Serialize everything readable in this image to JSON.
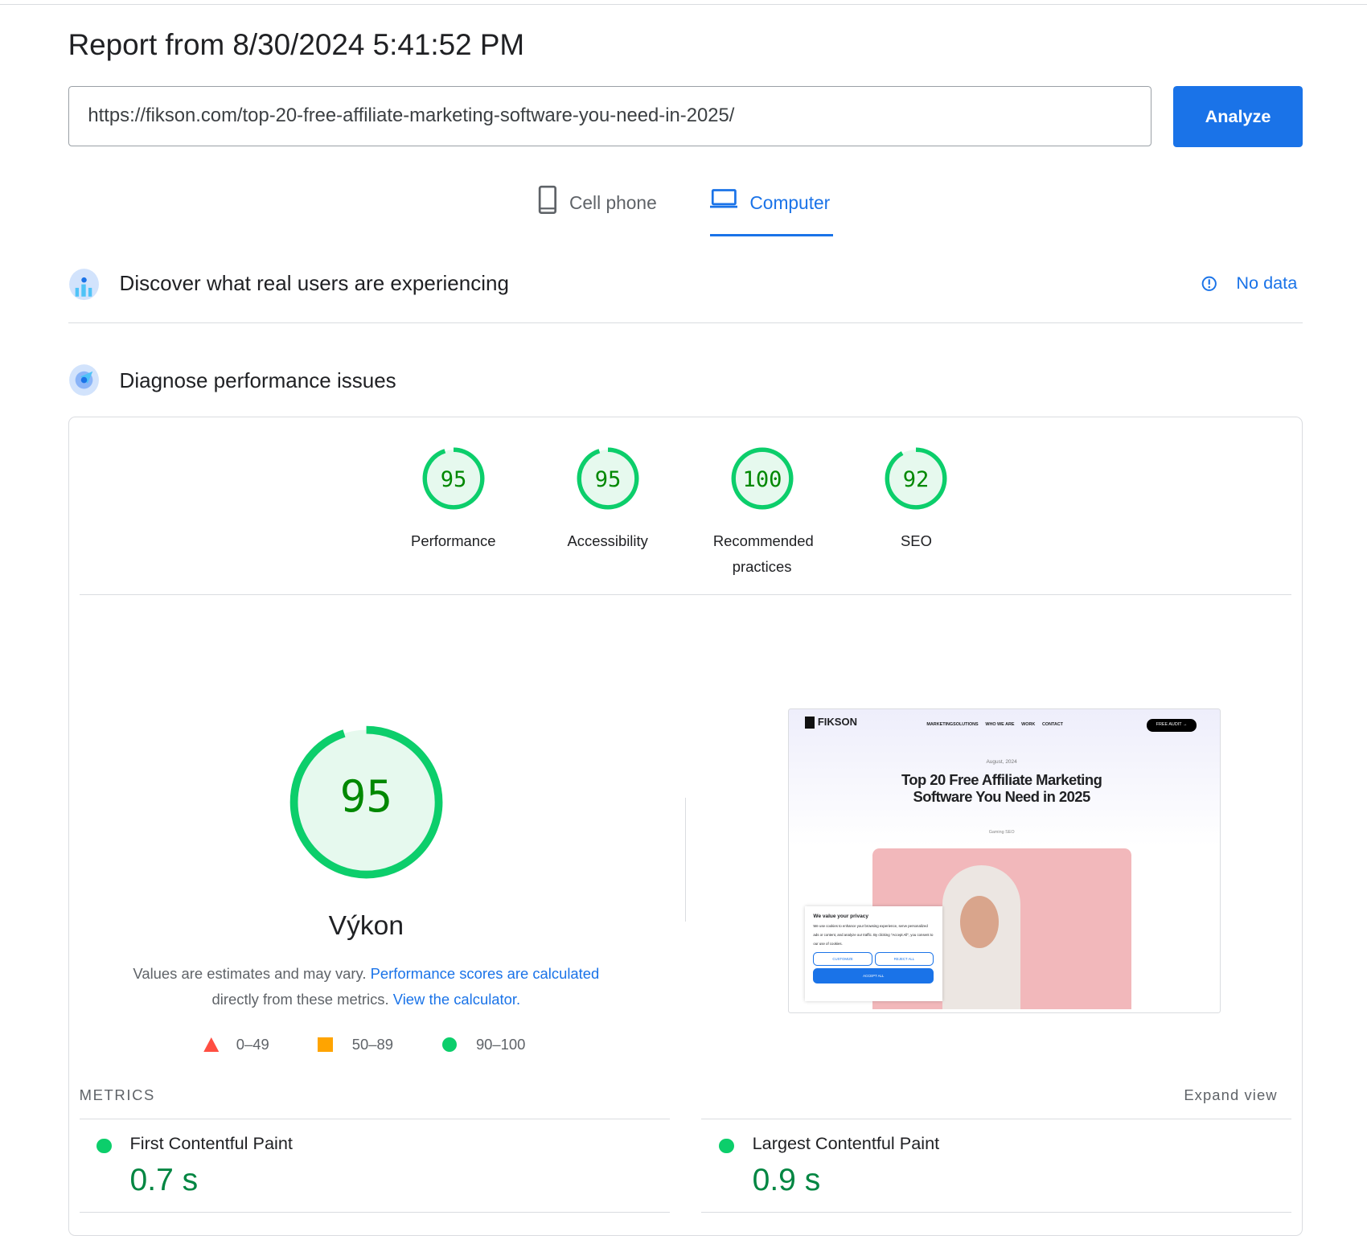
{
  "header": {
    "title": "Report from  8/30/2024 5:41:52 PM",
    "url": "https://fikson.com/top-20-free-affiliate-marketing-software-you-need-in-2025/",
    "analyze_label": "Analyze"
  },
  "tabs": [
    {
      "label": "Cell phone",
      "icon": "phone-icon",
      "active": false
    },
    {
      "label": "Computer",
      "icon": "laptop-icon",
      "active": true
    }
  ],
  "field": {
    "title": "Discover what real users are experiencing",
    "status": "No data"
  },
  "lab": {
    "title": "Diagnose performance issues"
  },
  "scores": [
    {
      "label": "Performance",
      "value": "95"
    },
    {
      "label": "Accessibility",
      "value": "95"
    },
    {
      "label": "Recommended practices",
      "value": "100"
    },
    {
      "label": "SEO",
      "value": "92"
    }
  ],
  "main_score": {
    "value": "95",
    "label": "Výkon",
    "desc1": "Values are estimates and may vary. ",
    "link1": "Performance scores are calculated",
    "desc2": "directly from these metrics. ",
    "link2": "View the calculator."
  },
  "legend": [
    {
      "range": "0–49",
      "color": "#ff4e42"
    },
    {
      "range": "50–89",
      "color": "#ffa400"
    },
    {
      "range": "90–100",
      "color": "#0cce6b"
    }
  ],
  "colors": {
    "good": "#0cce6b",
    "good_fill": "#e6f9ee",
    "good_text": "#008800",
    "accent": "#1a73e8"
  },
  "screenshot": {
    "brand": "FIKSON",
    "nav": [
      "MARKETINGSOLUTIONS",
      "WHO WE ARE",
      "WORK",
      "CONTACT"
    ],
    "cta": "FREE AUDIT →",
    "date": "August, 2024",
    "headline": "Top 20 Free Affiliate Marketing Software You Need in 2025",
    "category": "Gaming SEO",
    "cookie_title": "We value your privacy",
    "cookie_text": "We use cookies to enhance your browsing experience, serve personalized ads or content, and analyze our traffic. By clicking \"Accept All\", you consent to our use of cookies.",
    "customize": "CUSTOMIZE",
    "reject": "REJECT ALL",
    "accept": "ACCEPT ALL"
  },
  "metrics": {
    "heading": "METRICS",
    "expand": "Expand view",
    "items": [
      {
        "name": "First Contentful Paint",
        "value": "0.7 s"
      },
      {
        "name": "Largest Contentful Paint",
        "value": "0.9 s"
      }
    ]
  }
}
